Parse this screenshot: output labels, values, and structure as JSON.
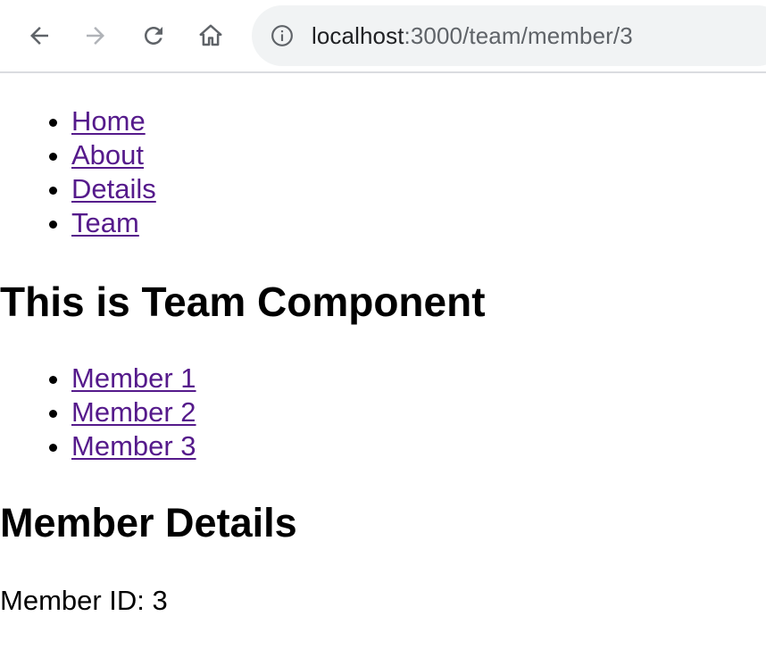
{
  "browser": {
    "back_icon": "arrow-left-icon",
    "forward_icon": "arrow-right-icon",
    "reload_icon": "reload-icon",
    "home_icon": "home-icon",
    "info_icon": "info-circle-icon",
    "url_host": "localhost",
    "url_rest": ":3000/team/member/3"
  },
  "nav": {
    "items": [
      {
        "label": "Home"
      },
      {
        "label": "About"
      },
      {
        "label": "Details"
      },
      {
        "label": "Team"
      }
    ]
  },
  "team": {
    "heading": "This is Team Component",
    "members": [
      {
        "label": "Member 1"
      },
      {
        "label": "Member 2"
      },
      {
        "label": "Member 3"
      }
    ]
  },
  "member_details": {
    "heading": "Member Details",
    "id_text": "Member ID: 3"
  },
  "colors": {
    "link": "#551a8b",
    "omnibox_bg": "#f1f3f4",
    "icon": "#5f6368",
    "icon_disabled": "#b0b3b8"
  }
}
